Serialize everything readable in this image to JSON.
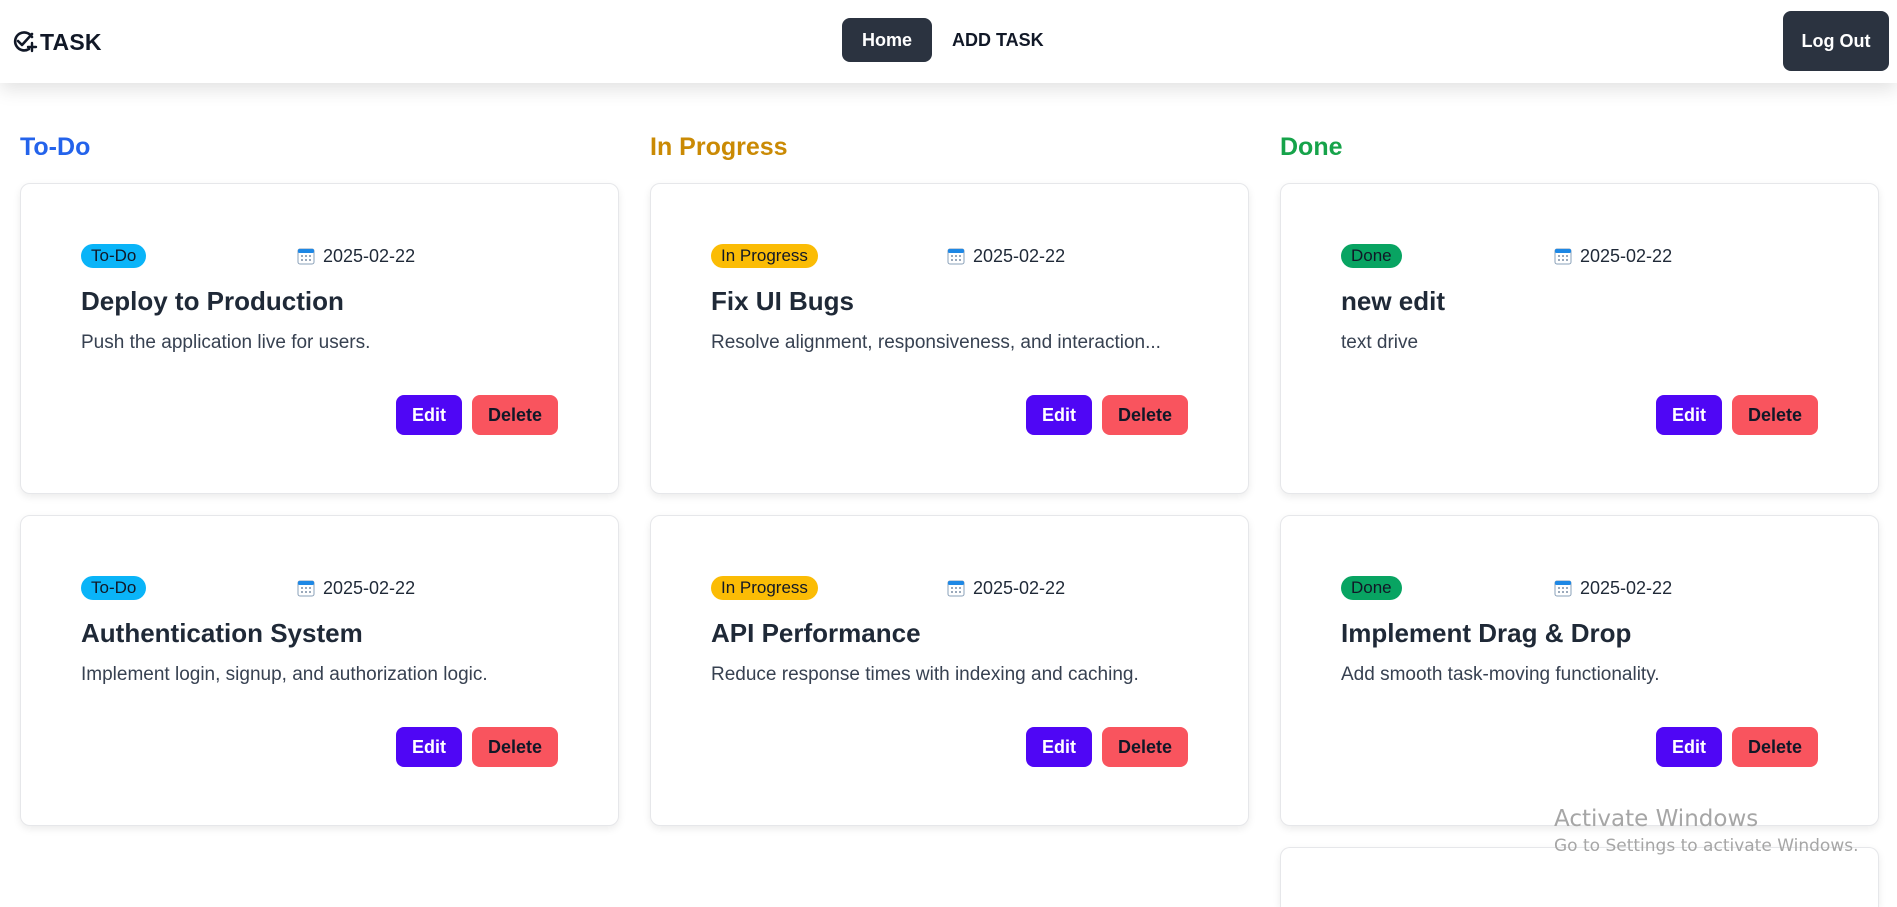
{
  "navbar": {
    "logo_text": "TASK",
    "home_label": "Home",
    "add_task_label": "ADD TASK",
    "logout_label": "Log Out"
  },
  "colors": {
    "todo": "#2463eb",
    "in_progress": "#ca8a04",
    "done": "#16a34a",
    "todo_badge": "#0ab4f8",
    "in_progress_badge": "#fbbc05",
    "done_badge": "#08a462",
    "edit": "#4f06f5",
    "delete": "#f9545e",
    "nav_dark": "#2b3340"
  },
  "columns": [
    {
      "title": "To-Do",
      "cards": [
        {
          "badge": "To-Do",
          "date": "2025-02-22",
          "title": "Deploy to Production",
          "description": "Push the application live for users.",
          "edit_label": "Edit",
          "delete_label": "Delete"
        },
        {
          "badge": "To-Do",
          "date": "2025-02-22",
          "title": "Authentication System",
          "description": "Implement login, signup, and authorization logic.",
          "edit_label": "Edit",
          "delete_label": "Delete"
        }
      ]
    },
    {
      "title": "In Progress",
      "cards": [
        {
          "badge": "In Progress",
          "date": "2025-02-22",
          "title": "Fix UI Bugs",
          "description": "Resolve alignment, responsiveness, and interaction...",
          "edit_label": "Edit",
          "delete_label": "Delete"
        },
        {
          "badge": "In Progress",
          "date": "2025-02-22",
          "title": "API Performance",
          "description": "Reduce response times with indexing and caching.",
          "edit_label": "Edit",
          "delete_label": "Delete"
        }
      ]
    },
    {
      "title": "Done",
      "cards": [
        {
          "badge": "Done",
          "date": "2025-02-22",
          "title": "new edit",
          "description": "text drive",
          "edit_label": "Edit",
          "delete_label": "Delete"
        },
        {
          "badge": "Done",
          "date": "2025-02-22",
          "title": "Implement Drag & Drop",
          "description": "Add smooth task-moving functionality.",
          "edit_label": "Edit",
          "delete_label": "Delete"
        }
      ]
    }
  ],
  "watermark": {
    "title": "Activate Windows",
    "subtitle": "Go to Settings to activate Windows."
  }
}
